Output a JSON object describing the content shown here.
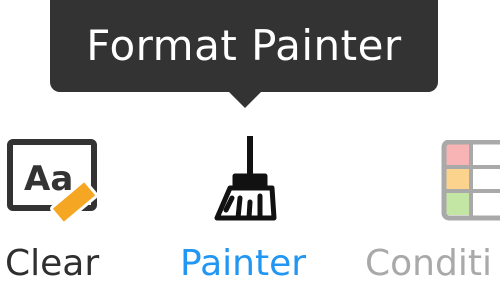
{
  "tooltip": {
    "text": "Format Painter"
  },
  "toolbar": {
    "items": [
      {
        "label": "Clear",
        "icon": "clear-format-icon",
        "icon_text": "Aa",
        "state": "normal"
      },
      {
        "label": "Painter",
        "icon": "paint-brush-icon",
        "state": "active"
      },
      {
        "label": "Conditi",
        "icon": "conditional-format-icon",
        "state": "disabled"
      }
    ]
  },
  "colors": {
    "tooltip_bg": "#333333",
    "active": "#2196f3",
    "disabled": "#a9a9a9",
    "eraser": "#f5a623"
  }
}
